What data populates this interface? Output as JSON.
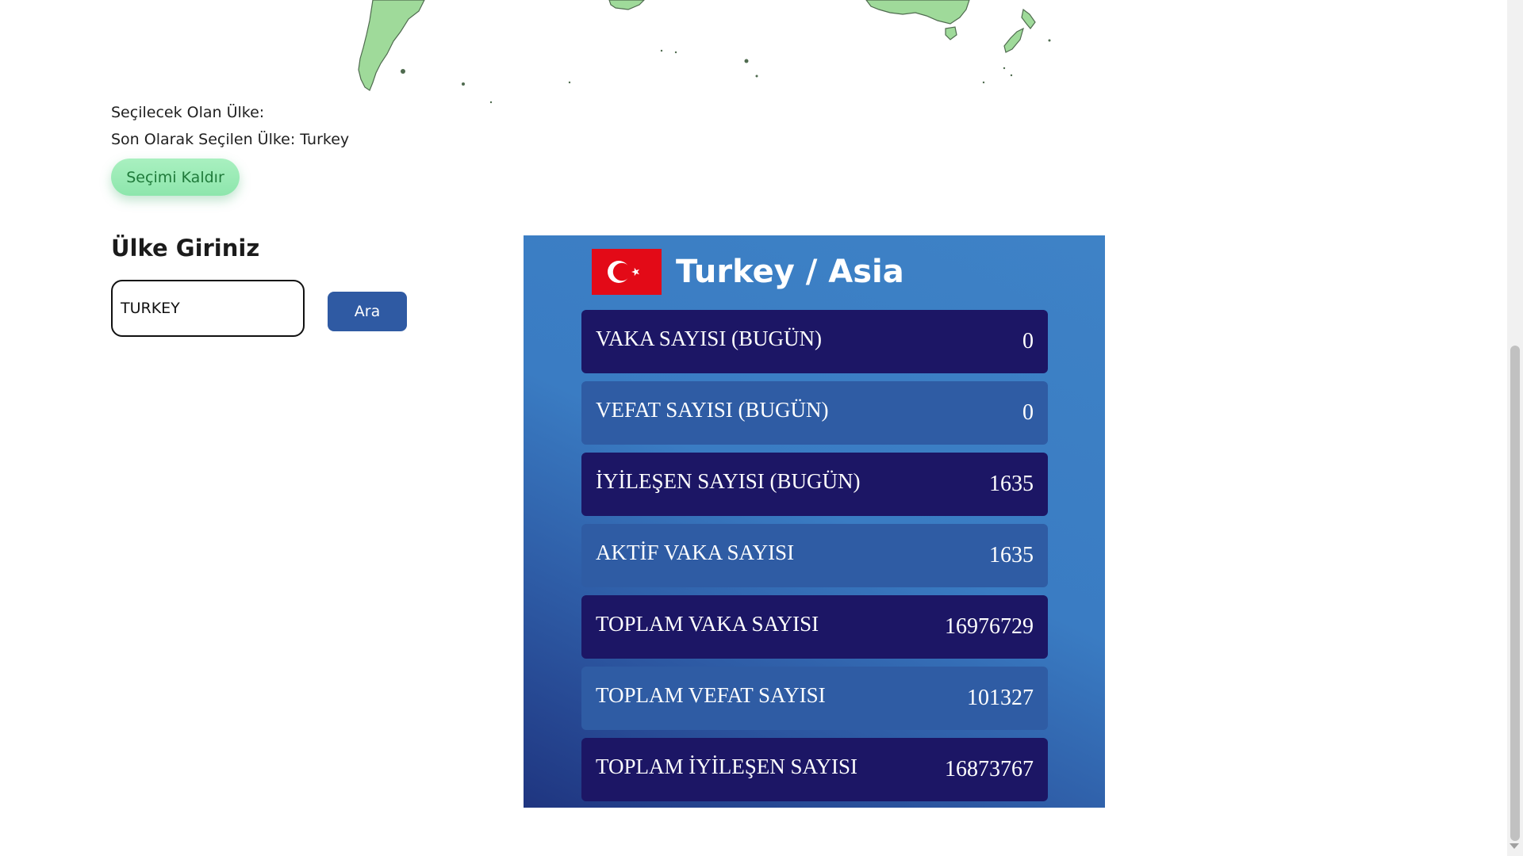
{
  "selection": {
    "next_label": "Seçilecek Olan Ülke:",
    "last_label": "Son Olarak Seçilen Ülke: Turkey",
    "clear_button": "Seçimi Kaldır"
  },
  "search": {
    "title": "Ülke Giriniz",
    "value": "TURKEY",
    "button": "Ara"
  },
  "panel": {
    "title": "Turkey / Asia",
    "flag_icon": "turkey-flag-icon",
    "stats": [
      {
        "label": "VAKA SAYISI (BUGÜN)",
        "value": "0"
      },
      {
        "label": "VEFAT SAYISI (BUGÜN)",
        "value": "0"
      },
      {
        "label": "İYİLEŞEN SAYISI (BUGÜN)",
        "value": "1635"
      },
      {
        "label": "AKTİF VAKA SAYISI",
        "value": "1635"
      },
      {
        "label": "TOPLAM VAKA SAYISI",
        "value": "16976729"
      },
      {
        "label": "TOPLAM VEFAT SAYISI",
        "value": "101327"
      },
      {
        "label": "TOPLAM İYİLEŞEN SAYISI",
        "value": "16873767"
      }
    ]
  },
  "colors": {
    "panel_blue": "#3e82c6",
    "row_dark": "#1c1665",
    "row_light": "#2f5ca4",
    "map_land": "#9fda9a",
    "clear_button": "#a9f0c0",
    "search_button": "#2f5aa3"
  }
}
